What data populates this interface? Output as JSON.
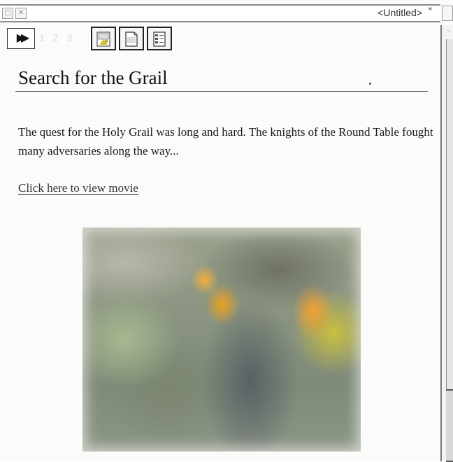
{
  "window": {
    "title": "<Untitled>",
    "modified_marker": "*"
  },
  "titlebar_icons": [
    "window-close-icon",
    "window-toggle-icon"
  ],
  "toolbar": {
    "forward_icon": "fast-forward-icon",
    "page_numbers": "1 2 3",
    "tools": [
      "picture-icon",
      "document-icon",
      "form-icon"
    ]
  },
  "content": {
    "heading": "Search for the Grail",
    "paragraph": "The quest for the Holy Grail was long and hard. The knights of the Round Table fought many adversaries along the way...",
    "link": "Click here to view movie",
    "image_name": "knights-photo"
  }
}
